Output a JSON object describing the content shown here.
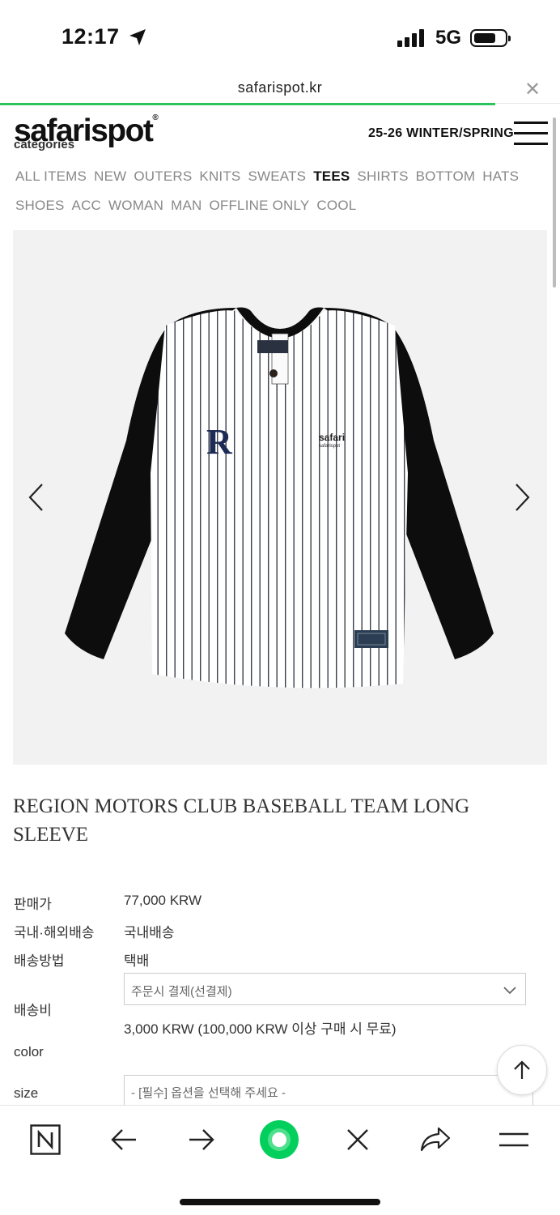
{
  "status": {
    "time": "12:17",
    "network": "5G"
  },
  "browser": {
    "url": "safarispot.kr",
    "load_progress": 0.885
  },
  "header": {
    "logo": "safarispot",
    "categories_heading": "categories",
    "season": "25-26 WINTER/SPRING"
  },
  "categories": [
    {
      "label": "ALL ITEMS",
      "active": false
    },
    {
      "label": "NEW",
      "active": false
    },
    {
      "label": "OUTERS",
      "active": false
    },
    {
      "label": "KNITS",
      "active": false
    },
    {
      "label": "SWEATS",
      "active": false
    },
    {
      "label": "TEES",
      "active": true
    },
    {
      "label": "SHIRTS",
      "active": false
    },
    {
      "label": "BOTTOM",
      "active": false
    },
    {
      "label": "HATS",
      "active": false
    },
    {
      "label": "SHOES",
      "active": false
    },
    {
      "label": "ACC",
      "active": false
    },
    {
      "label": "WOMAN",
      "active": false
    },
    {
      "label": "MAN",
      "active": false
    },
    {
      "label": "OFFLINE ONLY",
      "active": false
    },
    {
      "label": "COOL",
      "active": false
    }
  ],
  "product": {
    "title": "REGION MOTORS CLUB BASEBALL TEAM LONG SLEEVE",
    "image_text": {
      "emblem": "R",
      "brand_line1": "safari",
      "brand_line2": "safarispot"
    },
    "price_label": "판매가",
    "price": "77,000 KRW",
    "domestic_label": "국내·해외배송",
    "domestic_value": "국내배송",
    "method_label": "배송방법",
    "method_value": "택배",
    "fee_label": "배송비",
    "fee_select": "주문시 결제(선결제)",
    "fee_value": "3,000 KRW (100,000 KRW 이상 구매 시 무료)",
    "color_label": "color",
    "size_label": "size",
    "size_placeholder": "- [필수] 옵션을 선택해 주세요 -"
  },
  "icons": {
    "close": "close-icon",
    "menu": "hamburger-icon",
    "prev": "chevron-left-icon",
    "next": "chevron-right-icon",
    "top": "arrow-up-icon"
  },
  "colors": {
    "progress": "#2bc35b",
    "naver_green": "#03cf5d"
  }
}
